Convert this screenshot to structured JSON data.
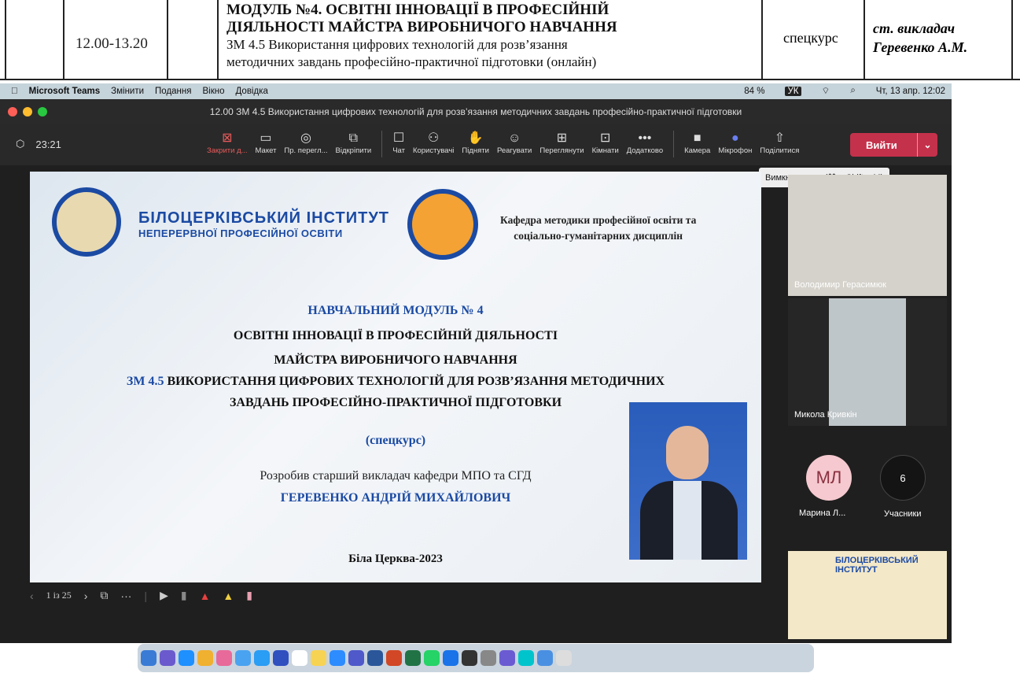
{
  "schedule": {
    "time": "12.00-13.20",
    "module_line1": "МОДУЛЬ №4. ОСВІТНІ ІННОВАЦІЇ В ПРОФЕСІЙНІЙ",
    "module_line2": "ДІЯЛЬНОСТІ МАЙСТРА ВИРОБНИЧОГО НАВЧАННЯ",
    "module_line3": "ЗМ 4.5 Використання цифрових технологій для розв’язання",
    "module_line4": "методичних завдань професійно-практичної підготовки (онлайн)",
    "kind": "спецкурс",
    "teacher_line1": "ст. викладач",
    "teacher_line2": "Геревенко А.М."
  },
  "menubar": {
    "app": "Microsoft Teams",
    "items": [
      "Змінити",
      "Подання",
      "Вікно",
      "Довідка"
    ],
    "battery": "84 %",
    "lang": "УК",
    "datetime": "Чт, 13 апр.  12:02"
  },
  "window": {
    "title": "12.00 ЗМ 4.5 Використання цифрових технологій для розв’язання методичних завдань професійно-практичної підготовки"
  },
  "toolbar": {
    "timer": "23:21",
    "tools": [
      {
        "label": "Закрити д...",
        "icon": "close-share-icon"
      },
      {
        "label": "Макет",
        "icon": "layout-icon"
      },
      {
        "label": "Пр. перегл...",
        "icon": "eye-icon"
      },
      {
        "label": "Відкріпити",
        "icon": "popout-icon"
      },
      {
        "label": "Чат",
        "icon": "chat-icon"
      },
      {
        "label": "Користувачі",
        "icon": "people-icon"
      },
      {
        "label": "Підняти",
        "icon": "hand-icon"
      },
      {
        "label": "Реагувати",
        "icon": "smile-icon"
      },
      {
        "label": "Переглянути",
        "icon": "grid-icon"
      },
      {
        "label": "Кімнати",
        "icon": "rooms-icon"
      },
      {
        "label": "Додатково",
        "icon": "more-icon"
      },
      {
        "label": "Камера",
        "icon": "camera-icon"
      },
      {
        "label": "Мікрофон",
        "icon": "mic-icon"
      },
      {
        "label": "Поділитися",
        "icon": "share-icon"
      }
    ],
    "leave": "Вийти",
    "tooltip": "Вимкнути звук (⌘ + Shift + M)"
  },
  "slide": {
    "inst_a": "БІЛОЦЕРКІВСЬКИЙ ІНСТИТУТ",
    "inst_b": "НЕПЕРЕРВНОЇ ПРОФЕСІЙНОЇ ОСВІТИ",
    "dept_1": "Кафедра методики професійної освіти та",
    "dept_2": "соціально-гуманітарних дисциплін",
    "l1": "НАВЧАЛЬНИЙ МОДУЛЬ № 4",
    "l2": "ОСВІТНІ ІННОВАЦІЇ В ПРОФЕСІЙНІЙ ДІЯЛЬНОСТІ",
    "l3": "МАЙСТРА ВИРОБНИЧОГО НАВЧАННЯ",
    "l4a": "ЗМ 4.5",
    "l4b": " ВИКОРИСТАННЯ ЦИФРОВИХ ТЕХНОЛОГІЙ ДЛЯ РОЗВ’ЯЗАННЯ МЕТОДИЧНИХ",
    "l5": "ЗАВДАНЬ ПРОФЕСІЙНО-ПРАКТИЧНОЇ ПІДГОТОВКИ",
    "l6": "(спецкурс)",
    "l7": "Розробив старший викладач кафедри МПО та СГД",
    "l8": "ГЕРЕВЕНКО АНДРІЙ МИХАЙЛОВИЧ",
    "l9": "Біла Церква-2023",
    "page": "1 із 25"
  },
  "participants": {
    "p1": "Володимир Герасимюк",
    "p2": "Микола Кривкін",
    "p3_initials": "МЛ",
    "p3": "Марина Л...",
    "count": "6",
    "count_label": "Учасники",
    "banner": "БІЛОЦЕРКІВСЬКИЙ ІНСТИТУТ"
  },
  "colors": {
    "accent": "#1b4aa3",
    "leave": "#c4314b"
  }
}
